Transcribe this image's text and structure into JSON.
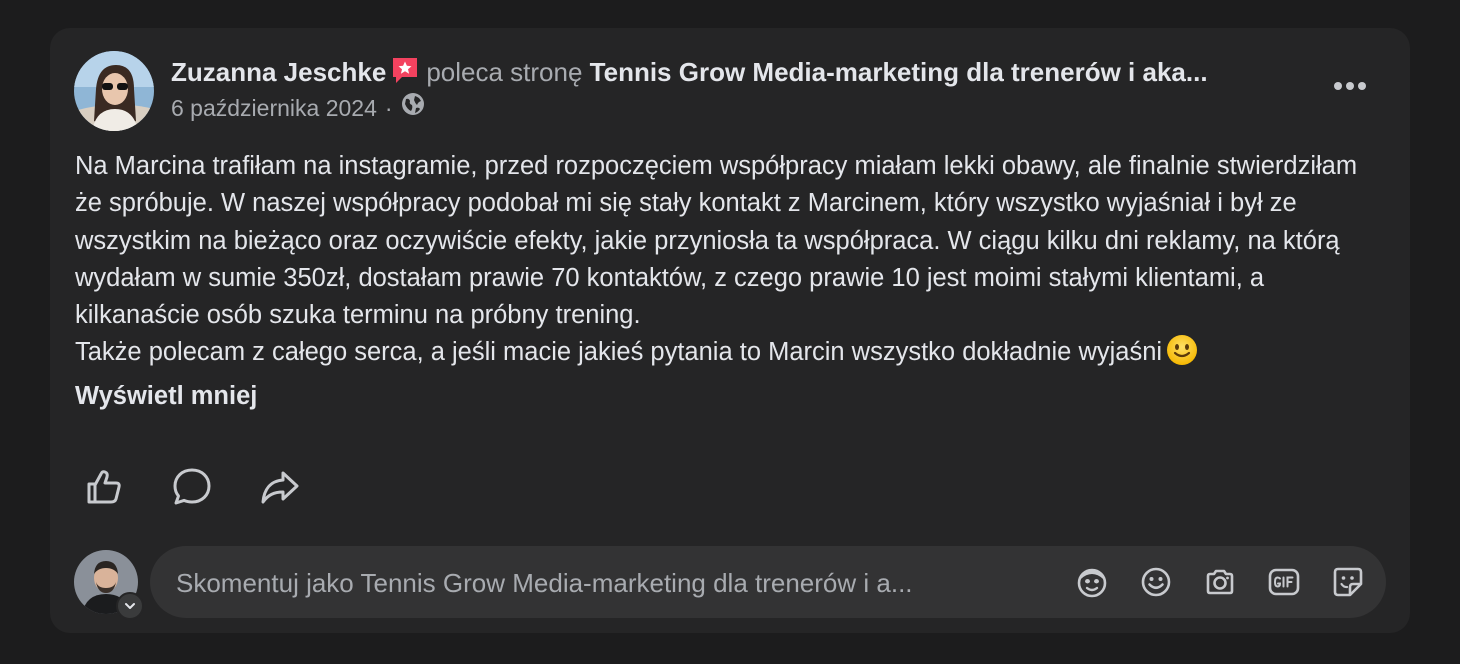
{
  "post": {
    "author": "Zuzanna Jeschke",
    "recommends_text": "poleca stronę",
    "page_name": "Tennis Grow Media-marketing dla trenerów i aka...",
    "date": "6 października 2024",
    "separator": "·",
    "audience_icon": "globe-icon",
    "body_paragraph_1": "Na Marcina trafiłam na instagramie, przed rozpoczęciem współpracy miałam lekki obawy, ale finalnie stwierdziłam że spróbuje. W naszej współpracy podobał mi się stały kontakt z Marcinem, który wszystko wyjaśniał i był ze wszystkim na bieżąco oraz oczywiście efekty, jakie przyniosła ta współpraca. W ciągu kilku dni reklamy, na którą wydałam w sumie 350zł, dostałam prawie 70 kontaktów, z czego prawie 10 jest moimi stałymi klientami, a kilkanaście osób szuka terminu na próbny trening.",
    "body_paragraph_2": "Także polecam z całego serca, a jeśli macie jakieś pytania to Marcin wszystko dokładnie wyjaśni",
    "show_less_label": "Wyświetl mniej"
  },
  "actions": {
    "like_icon": "thumbs-up-icon",
    "comment_icon": "comment-bubble-icon",
    "share_icon": "share-arrow-icon"
  },
  "comment": {
    "placeholder": "Skomentuj jako Tennis Grow Media-marketing dla trenerów i a...",
    "icons": [
      "avatar-sticker-icon",
      "emoji-icon",
      "camera-icon",
      "gif-icon",
      "sticker-icon"
    ]
  },
  "colors": {
    "background": "#1c1c1d",
    "card": "#252526",
    "text_primary": "#e4e6eb",
    "text_secondary": "#a8abb0",
    "recommend_badge": "#f3425f"
  }
}
